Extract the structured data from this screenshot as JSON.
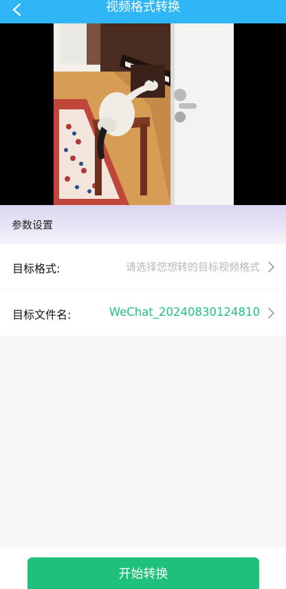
{
  "header": {
    "title": "视频格式转换",
    "back_icon": "chevron-left-icon"
  },
  "video": {
    "description_icon": "video-frame"
  },
  "params": {
    "section_label": "参数设置"
  },
  "settings": {
    "target_format": {
      "label": "目标格式:",
      "placeholder": "请选择您想转的目标视频格式"
    },
    "target_filename": {
      "label": "目标文件名:",
      "value": "WeChat_20240830124810"
    }
  },
  "actions": {
    "start_label": "开始转换"
  },
  "colors": {
    "header": "#2eb6f6",
    "accent_green": "#1ec27b",
    "button_green": "#1fc07a"
  }
}
